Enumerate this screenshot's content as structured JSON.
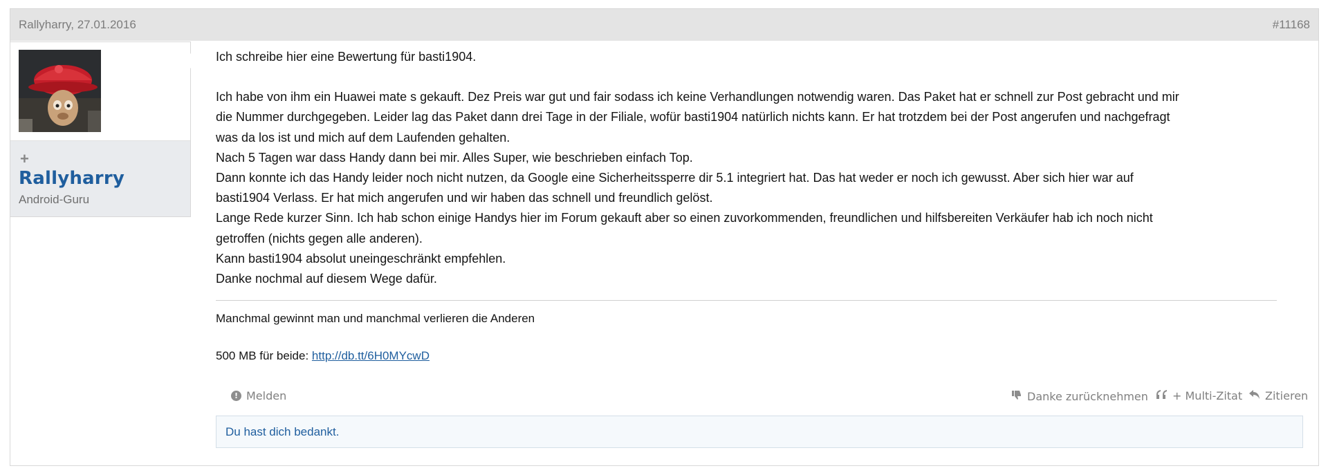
{
  "header": {
    "author_date": "Rallyharry, 27.01.2016",
    "post_number": "#11168"
  },
  "user": {
    "name": "Rallyharry",
    "title": "Android-Guru"
  },
  "post": {
    "lines": [
      "Ich schreibe hier eine Bewertung für basti1904.",
      "",
      "Ich habe von ihm ein Huawei mate s gekauft. Dez Preis war gut und fair sodass ich keine Verhandlungen notwendig waren. Das Paket hat er schnell zur Post gebracht und mir",
      "die Nummer durchgegeben. Leider lag das Paket dann drei Tage in der Filiale, wofür basti1904 natürlich nichts kann. Er hat trotzdem bei der Post angerufen und nachgefragt",
      "was da los ist und mich auf dem Laufenden gehalten.",
      "Nach 5 Tagen war dass Handy dann bei mir. Alles Super, wie beschrieben einfach Top.",
      "Dann konnte ich das Handy leider noch nicht nutzen, da Google eine Sicherheitssperre dir 5.1 integriert hat. Das hat weder er noch ich gewusst. Aber sich hier war auf",
      "basti1904 Verlass. Er hat mich angerufen und wir haben das schnell und freundlich gelöst.",
      "Lange Rede kurzer Sinn. Ich hab schon einige Handys hier im Forum gekauft aber so einen zuvorkommenden, freundlichen und hilfsbereiten Verkäufer hab ich noch nicht",
      "getroffen (nichts gegen alle anderen).",
      "Kann basti1904 absolut uneingeschränkt empfehlen.",
      "Danke nochmal auf diesem Wege dafür."
    ]
  },
  "signature": {
    "line1": "Manchmal gewinnt man und manchmal verlieren die Anderen",
    "line2_prefix": "500 MB für beide: ",
    "link_text": "http://db.tt/6H0MYcwD"
  },
  "actions": {
    "report": "Melden",
    "unthank": "Danke zurücknehmen",
    "multiquote": "+ Multi-Zitat",
    "quote": "Zitieren"
  },
  "thanked_notice": "Du hast dich bedankt.",
  "icons": {
    "report": "exclamation-circle-icon",
    "unthank": "thumbs-down-icon",
    "multiquote": "quote-icon",
    "quote": "reply-icon",
    "expand": "plus-icon"
  }
}
